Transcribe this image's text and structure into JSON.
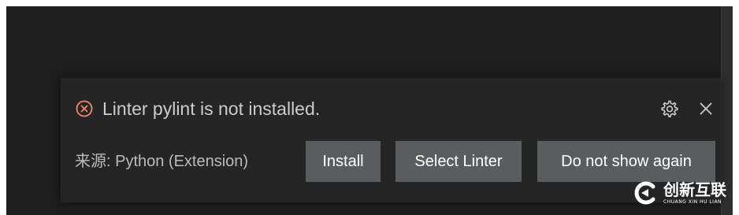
{
  "notification": {
    "severity": "error",
    "severity_icon": "error-circle-x-icon",
    "message": "Linter pylint is not installed.",
    "source": "来源: Python (Extension)",
    "gear_icon": "gear-icon",
    "close_icon": "close-icon",
    "buttons": [
      {
        "label": "Install"
      },
      {
        "label": "Select Linter"
      },
      {
        "label": "Do not show again"
      }
    ]
  },
  "watermark": {
    "logo_icon": "brand-logo-icon",
    "text_cn": "创新互联",
    "text_en": "CHUANG XIN HU LIAN"
  },
  "colors": {
    "editor_bg": "#1e1e1e",
    "notification_bg": "#252526",
    "button_bg": "#5a5d5e",
    "error_icon": "#f48771",
    "text": "#cccccc"
  }
}
